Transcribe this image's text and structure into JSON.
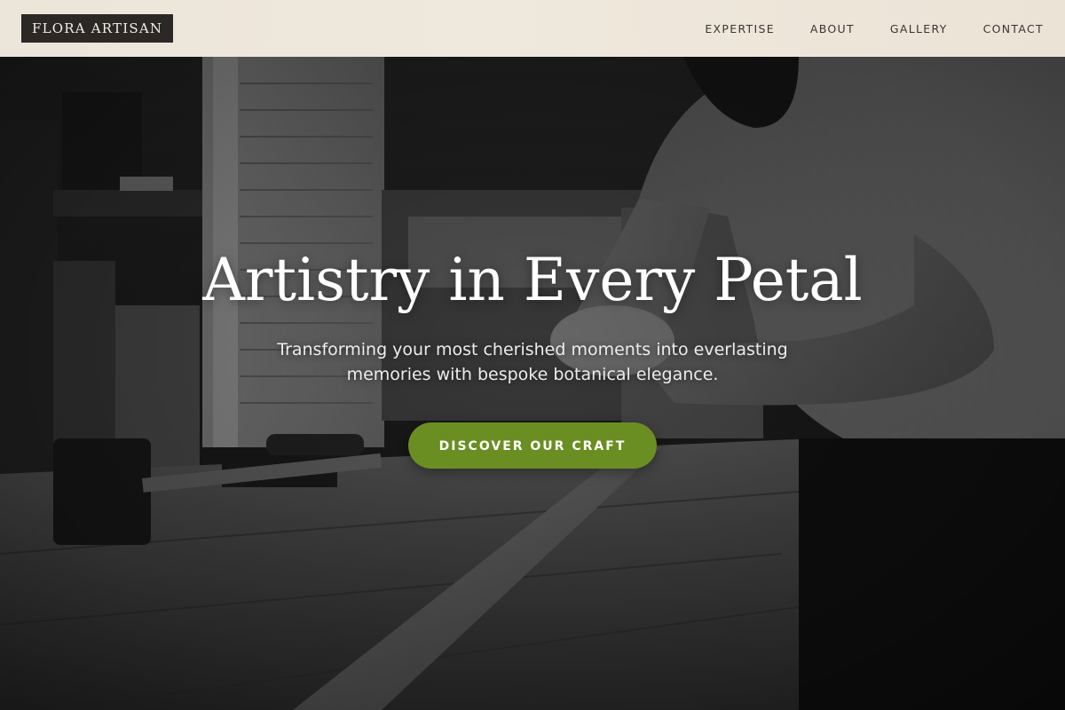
{
  "nav": {
    "logo": "FLORA ARTISAN",
    "links": [
      "EXPERTISE",
      "ABOUT",
      "GALLERY",
      "CONTACT"
    ]
  },
  "hero": {
    "title": "Artistry in Every Petal",
    "subtitle": "Transforming your most cherished moments into everlasting memories with bespoke botanical elegance.",
    "cta_label": "DISCOVER OUR CRAFT",
    "background": "black-and-white photo of a craftsman working with wood at a workshop bench"
  },
  "colors": {
    "nav_background": "#ece5d9",
    "logo_background": "#2b2826",
    "cta_background": "#6b8e23",
    "text_light": "#ffffff"
  }
}
